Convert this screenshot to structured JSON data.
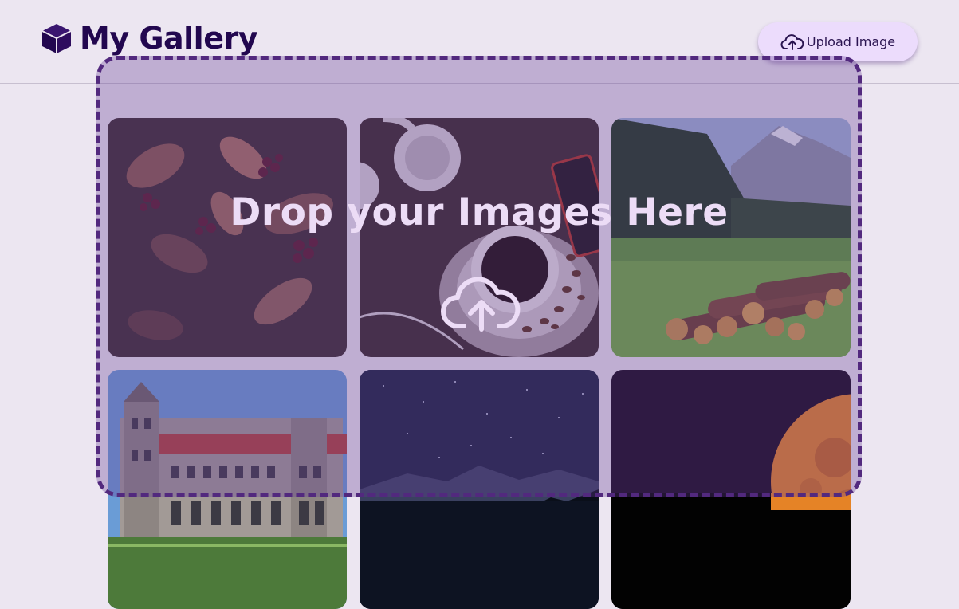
{
  "header": {
    "title": "My Gallery",
    "logo_icon": "cube-icon",
    "upload_button": {
      "label": "Upload Image",
      "icon": "cloud-upload-icon"
    }
  },
  "gallery": {
    "images": [
      {
        "subject": "berry-leaves"
      },
      {
        "subject": "coffee-headphones"
      },
      {
        "subject": "mountain-logs"
      },
      {
        "subject": "castle"
      },
      {
        "subject": "starry-lake"
      },
      {
        "subject": "orange-moon"
      }
    ]
  },
  "dropzone": {
    "title": "Drop your Images Here",
    "icon": "cloud-upload-icon"
  },
  "colors": {
    "background": "#ece6f1",
    "brand": "#22074f",
    "button": "#ecdcfc",
    "dropzone_border": "#52297e"
  }
}
